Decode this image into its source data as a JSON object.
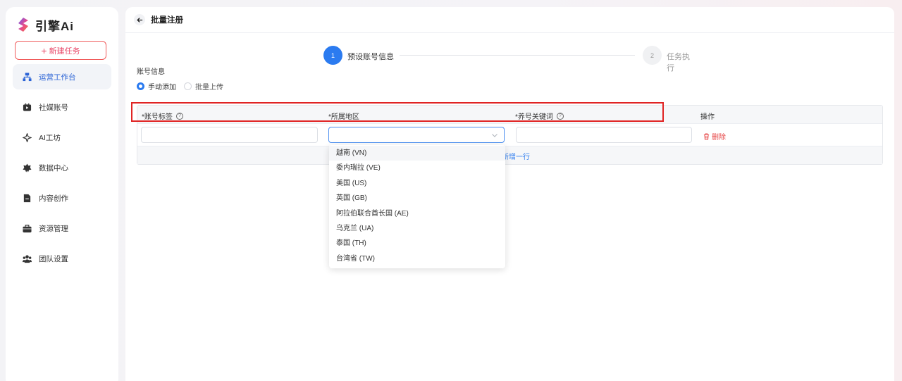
{
  "brand": {
    "name": "引擎Ai"
  },
  "sidebar": {
    "new_task_label": "新建任务",
    "items": [
      {
        "label": "运营工作台",
        "icon": "sitemap-icon",
        "active": true
      },
      {
        "label": "社媒账号",
        "icon": "video-account-icon",
        "active": false
      },
      {
        "label": "AI工坊",
        "icon": "ai-sparkle-icon",
        "active": false
      },
      {
        "label": "数据中心",
        "icon": "star-badge-icon",
        "active": false
      },
      {
        "label": "内容创作",
        "icon": "document-icon",
        "active": false
      },
      {
        "label": "资源管理",
        "icon": "briefcase-icon",
        "active": false
      },
      {
        "label": "团队设置",
        "icon": "team-icon",
        "active": false
      }
    ]
  },
  "header": {
    "title": "批量注册"
  },
  "steps": [
    {
      "number": "1",
      "label": "预设账号信息",
      "active": true
    },
    {
      "number": "2",
      "label": "任务执行",
      "active": false
    }
  ],
  "form": {
    "section_label": "账号信息",
    "radio_options": [
      {
        "label": "手动添加",
        "selected": true
      },
      {
        "label": "批量上传",
        "selected": false
      }
    ]
  },
  "table": {
    "headers": {
      "tag": "*账号标签",
      "region": "*所属地区",
      "keywords": "*养号关键词",
      "actions": "操作"
    },
    "row": {
      "tag_value": "",
      "region_value": "",
      "keywords_value": "",
      "delete_label": "删除"
    },
    "add_row_label": "新增一行"
  },
  "region_dropdown": {
    "options": [
      "越南 (VN)",
      "委内瑞拉 (VE)",
      "美国 (US)",
      "英国 (GB)",
      "阿拉伯联合酋长国 (AE)",
      "乌克兰 (UA)",
      "泰国 (TH)",
      "台湾省 (TW)"
    ]
  },
  "colors": {
    "primary": "#2b7bf0",
    "accent_red": "#e94a6a",
    "highlight": "#e02424",
    "danger": "#e64545"
  }
}
